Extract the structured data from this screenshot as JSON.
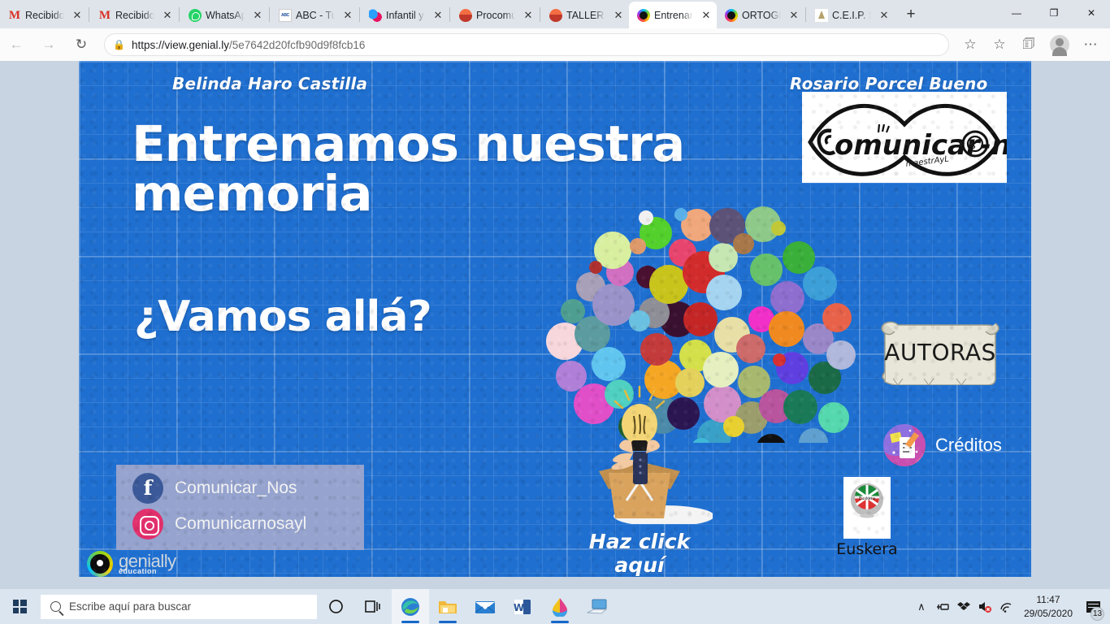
{
  "browser": {
    "tabs": [
      {
        "label": "Recibidos",
        "icon": "gmail-icon",
        "active": false
      },
      {
        "label": "Recibidos",
        "icon": "gmail-icon",
        "active": false
      },
      {
        "label": "WhatsAp",
        "icon": "whatsapp-icon",
        "active": false
      },
      {
        "label": "ABC - Tu",
        "icon": "abc-icon",
        "active": false
      },
      {
        "label": "Infantil y",
        "icon": "infantil-icon",
        "active": false
      },
      {
        "label": "Procomú",
        "icon": "procomun-icon",
        "active": false
      },
      {
        "label": "TALLER D",
        "icon": "procomun-icon",
        "active": false
      },
      {
        "label": "Entrenam",
        "icon": "genially-icon",
        "active": true
      },
      {
        "label": "ORTOGR",
        "icon": "genially-icon",
        "active": false
      },
      {
        "label": "C.E.I.P. SA",
        "icon": "ceip-icon",
        "active": false
      }
    ],
    "new_tab_label": "+",
    "window_controls": {
      "minimize": "─",
      "maximize": "❐",
      "close": "✕"
    },
    "nav": {
      "back": "←",
      "forward": "→",
      "reload": "↻",
      "lock": "ὑ2",
      "url_host": "https://view.genial.ly",
      "url_path": "/5e7642d20fcfb90d9f8fcb16",
      "url_full": "https://view.genial.ly/5e7642d20fcfb90d9f8fcb16",
      "favorite": "☆",
      "favorites_bar": "favorites-icon",
      "collections": "collections-icon",
      "profile": "profile-avatar",
      "settings": "⋯"
    }
  },
  "slide": {
    "author_left": "Belinda Haro Castilla",
    "author_right": "Rosario Porcel Bueno",
    "title_line1": "Entrenamos nuestra",
    "title_line2": "memoria",
    "subtitle": "¿Vamos allá?",
    "logo_text": "Comunicar-nos",
    "logo_subtext": "maestrAyL",
    "social": [
      {
        "network": "facebook",
        "handle": "Comunicar_Nos"
      },
      {
        "network": "instagram",
        "handle": "Comunicarnosayl"
      }
    ],
    "click_here_label": "Haz click aquí",
    "autoras_label": "AUTORAS",
    "creditos_label": "Créditos",
    "euskera_label": "Euskera",
    "float_hand": "hand-pointer-icon",
    "float_menu": "•••",
    "watermark_name": "genially",
    "watermark_sub": "education",
    "colors": {
      "slide_bg": "#1f6fd0",
      "grid_line": "#5c9ae0",
      "social_box": "#9ea7ce",
      "facebook": "#3b5998",
      "instagram": "#e1306c",
      "float_btn": "#6e7793",
      "title_text": "#ffffff"
    }
  },
  "taskbar": {
    "start": "windows-logo",
    "search_placeholder": "Escribe aquí para buscar",
    "cortana": "cortana-icon",
    "task_view": "task-view-icon",
    "pinned": [
      {
        "name": "microsoft-edge",
        "running": true,
        "active": true
      },
      {
        "name": "file-explorer",
        "running": true,
        "active": false
      },
      {
        "name": "mail",
        "running": false,
        "active": false
      },
      {
        "name": "microsoft-word",
        "running": false,
        "active": false
      },
      {
        "name": "paint-3d",
        "running": true,
        "active": false
      },
      {
        "name": "remote-desktop",
        "running": false,
        "active": false
      }
    ],
    "tray": {
      "show_hidden": "∧",
      "icons": [
        "usb-icon",
        "dropbox-icon",
        "volume-muted-icon",
        "wifi-icon"
      ],
      "time": "11:47",
      "date": "29/05/2020",
      "notification_count": "13"
    }
  }
}
